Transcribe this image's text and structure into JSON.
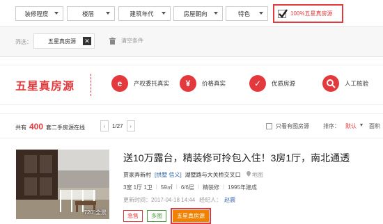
{
  "filters": {
    "dropdowns": [
      "装修程度",
      "楼层",
      "建筑年代",
      "房屋朝向",
      "特色"
    ],
    "star_checkbox_label": "100%五星真房源"
  },
  "selected": {
    "label": "筛选：",
    "tag": "五星真房源",
    "remove": "✕",
    "clear": "清空条件"
  },
  "banner": {
    "title": "五星真房源",
    "features": [
      {
        "icon": "e",
        "label": "产权委托真实"
      },
      {
        "icon": "¥",
        "label": "价格真实"
      },
      {
        "icon": "✓",
        "label": "优质房源"
      },
      {
        "icon": "🔍",
        "label": "人工核验"
      }
    ]
  },
  "list_header": {
    "prefix": "共有",
    "count": "400",
    "suffix": "套二手房源在线",
    "prev": "‹",
    "page": "1/27",
    "next": "›",
    "pic_only": "只看有图房源",
    "sort_label": "排序：",
    "sort_default": "默认",
    "sort_arrow": "▾",
    "sort_area": "面积"
  },
  "listing": {
    "title": "送10万露台，精装修可拎包入住！3房1厅，南北通透",
    "community": "贾家弄新村",
    "district": "[拱墅 信义]",
    "road": "湖墅路与大关桥交叉口",
    "map": "地图",
    "layout": "3室 1厅 1卫",
    "area": "59㎡",
    "floor": "6/6层",
    "decoration": "精装修",
    "year": "1995年建成",
    "update_label": "更新时间：2017-04-18 14:44",
    "agent_label": "经纪人：",
    "agent": "赵震",
    "pano_label": "720°全景",
    "tags": {
      "urgent": "急售",
      "multi": "多图",
      "star": "五星真房源"
    }
  }
}
